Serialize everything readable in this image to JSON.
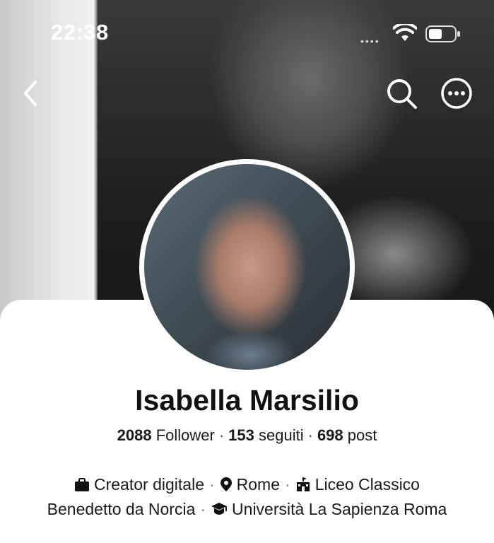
{
  "status_bar": {
    "time": "22:38"
  },
  "profile": {
    "name": "Isabella Marsilio",
    "followers_count": "2088",
    "followers_label": "Follower",
    "following_count": "153",
    "following_label": "seguiti",
    "posts_count": "698",
    "posts_label": "post"
  },
  "details": {
    "category": "Creator digitale",
    "location": "Rome",
    "school_part1": "Liceo Classico",
    "school_part2": "Benedetto da Norcia",
    "university": "Università La Sapienza Roma"
  },
  "icons": [
    "back-icon",
    "search-icon",
    "more-icon",
    "wifi-icon",
    "battery-icon",
    "briefcase-icon",
    "location-pin-icon",
    "school-icon",
    "graduation-cap-icon"
  ]
}
